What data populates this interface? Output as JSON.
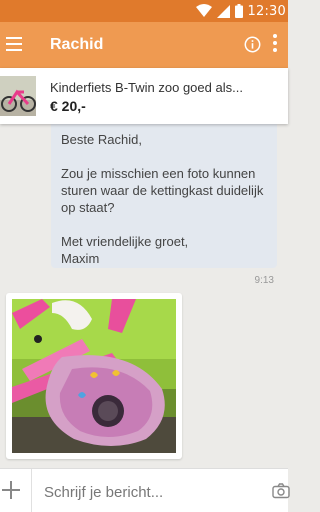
{
  "status_bar": {
    "time": "12:30",
    "icons": [
      "wifi-icon",
      "signal-icon",
      "battery-icon"
    ],
    "color": "#e07a2c"
  },
  "app_bar": {
    "title": "Rachid",
    "color": "#ef9a51",
    "icons": [
      "menu-icon",
      "info-icon",
      "more-vert-icon"
    ]
  },
  "listing": {
    "title": "Kinderfiets B-Twin zoo goed als...",
    "price": "€ 20,-"
  },
  "message": {
    "lines": [
      "Beste Rachid,",
      "Zou je misschien een foto kunnen sturen waar de kettingkast duidelijk op staat?",
      "Met vriendelijke groet,",
      "Maxim"
    ],
    "time": "9:13",
    "bubble_color": "#e3e8ef"
  },
  "photo": {
    "icon": "bike-photo"
  },
  "compose": {
    "placeholder": "Schrijf je bericht...",
    "icons": [
      "plus-icon",
      "camera-icon"
    ]
  }
}
